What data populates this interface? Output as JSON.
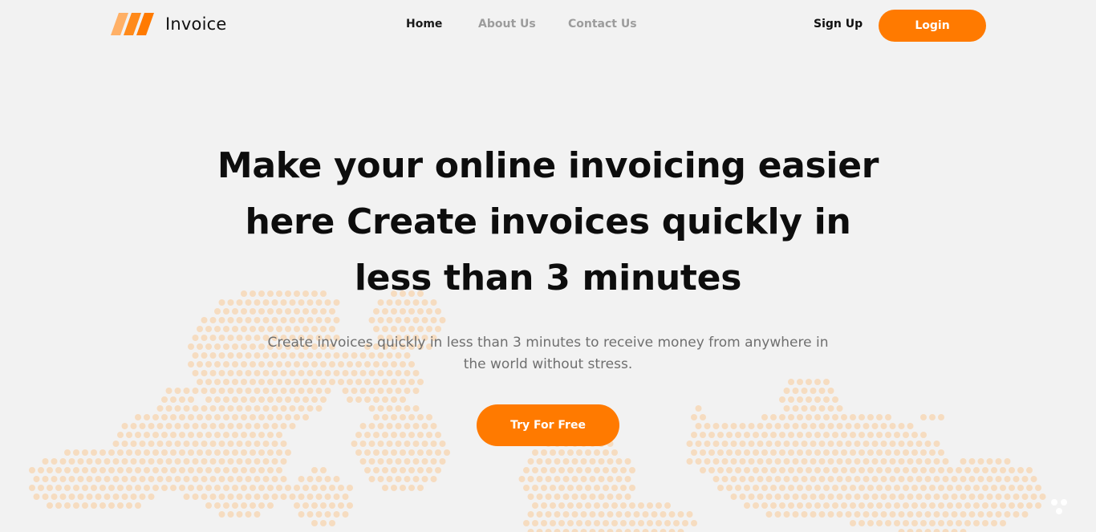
{
  "brand": {
    "name": "Invoice",
    "accent_color": "#ff7a00",
    "logo_icon": "slanted-bars-icon"
  },
  "nav": {
    "items": [
      {
        "label": "Home",
        "active": true
      },
      {
        "label": "About Us",
        "active": false
      },
      {
        "label": "Contact Us",
        "active": false
      }
    ]
  },
  "auth": {
    "signup_label": "Sign Up",
    "login_label": "Login"
  },
  "hero": {
    "title_lines": [
      "Make your online invoicing easier",
      "here Create invoices quickly in",
      "less than 3 minutes"
    ],
    "subtitle_lines": [
      "Create invoices quickly in less than 3 minutes to receive money from anywhere in",
      "the world without stress."
    ],
    "cta_label": "Try For Free"
  },
  "background": {
    "map_dot_color": "#f6dcc0",
    "page_color": "#f2f2f2"
  }
}
